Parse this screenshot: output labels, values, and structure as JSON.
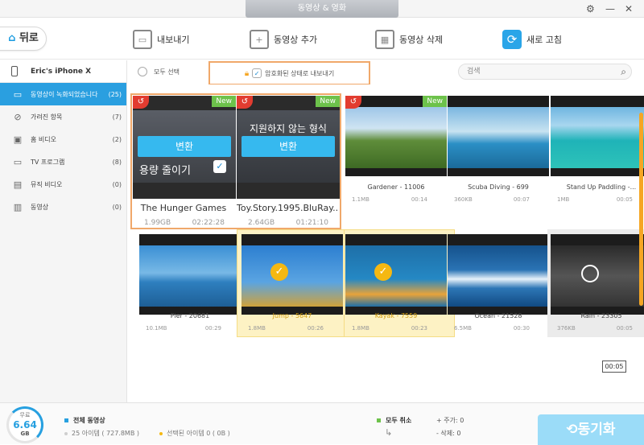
{
  "window": {
    "title": "동영상 & 영화",
    "gear_icon": "gear-icon",
    "minimize": "—",
    "close": "✕"
  },
  "toolbar": {
    "back_label": "뒤로",
    "export_label": "내보내기",
    "add_label": "동영상 추가",
    "delete_label": "동영상 삭제",
    "refresh_label": "새로 고침"
  },
  "sidebar": {
    "device": "Eric's iPhone X",
    "items": [
      {
        "label": "동영상이 녹화되었습니다",
        "count": "(25)",
        "icon": "record-video-icon"
      },
      {
        "label": "가려진 항목",
        "count": "(7)",
        "icon": "hidden-eye-icon"
      },
      {
        "label": "홈 비디오",
        "count": "(2)",
        "icon": "home-video-icon"
      },
      {
        "label": "TV 프로그램",
        "count": "(8)",
        "icon": "tv-icon"
      },
      {
        "label": "뮤직 비디오",
        "count": "(0)",
        "icon": "music-video-icon"
      },
      {
        "label": "동영상",
        "count": "(0)",
        "icon": "film-icon"
      }
    ]
  },
  "filter": {
    "select_all": "모두 선택",
    "encrypt_export": "암호화된 상태로 내보내기",
    "search_placeholder": "검색"
  },
  "big_cards": [
    {
      "overlay_title": "",
      "convert": "변환",
      "reduce": "용량 줄이기",
      "title": "The Hunger Games",
      "size": "1.99GB",
      "duration": "02:22:28",
      "new_badge": "New"
    },
    {
      "overlay_title": "지원하지 않는 형식",
      "convert": "변환",
      "title": "Toy.Story.1995.BluRay....",
      "size": "2.64GB",
      "duration": "01:21:10",
      "new_badge": "New"
    }
  ],
  "cards": [
    {
      "title": "Gardener - 11006",
      "size": "1.1MB",
      "duration": "00:14",
      "new_badge": "New"
    },
    {
      "title": "Scuba Diving - 699",
      "size": "360KB",
      "duration": "00:07"
    },
    {
      "title": "Stand Up Paddling -...",
      "size": "1MB",
      "duration": "00:05"
    },
    {
      "title": "Pier - 20681",
      "size": "10.1MB",
      "duration": "00:29"
    },
    {
      "title": "Jump - 5647",
      "size": "1.8MB",
      "duration": "00:26"
    },
    {
      "title": "Kayak - 7559",
      "size": "1.8MB",
      "duration": "00:23"
    },
    {
      "title": "Ocean - 21528",
      "size": "6.5MB",
      "duration": "00:30"
    },
    {
      "title": "Rain - 23305",
      "size": "376KB",
      "duration": "00:05"
    }
  ],
  "time_tip": "00:05",
  "footer": {
    "free_label": "무료",
    "free_value": "6.64",
    "free_unit": "GB",
    "total_label": "전체 동영상",
    "items_summary": "25 아이템 ( 727.8MB )",
    "selected_summary": "선택된 아이템 0 ( 0B )",
    "cancel_all": "모두 취소",
    "added": "+ 주가: 0",
    "deleted": "- 삭제: 0",
    "sync": "동기화"
  },
  "colors": {
    "accent": "#2a9fe0",
    "highlight": "#f0a86a",
    "selected": "#fdf2c4",
    "new_badge": "#6dc24b"
  }
}
